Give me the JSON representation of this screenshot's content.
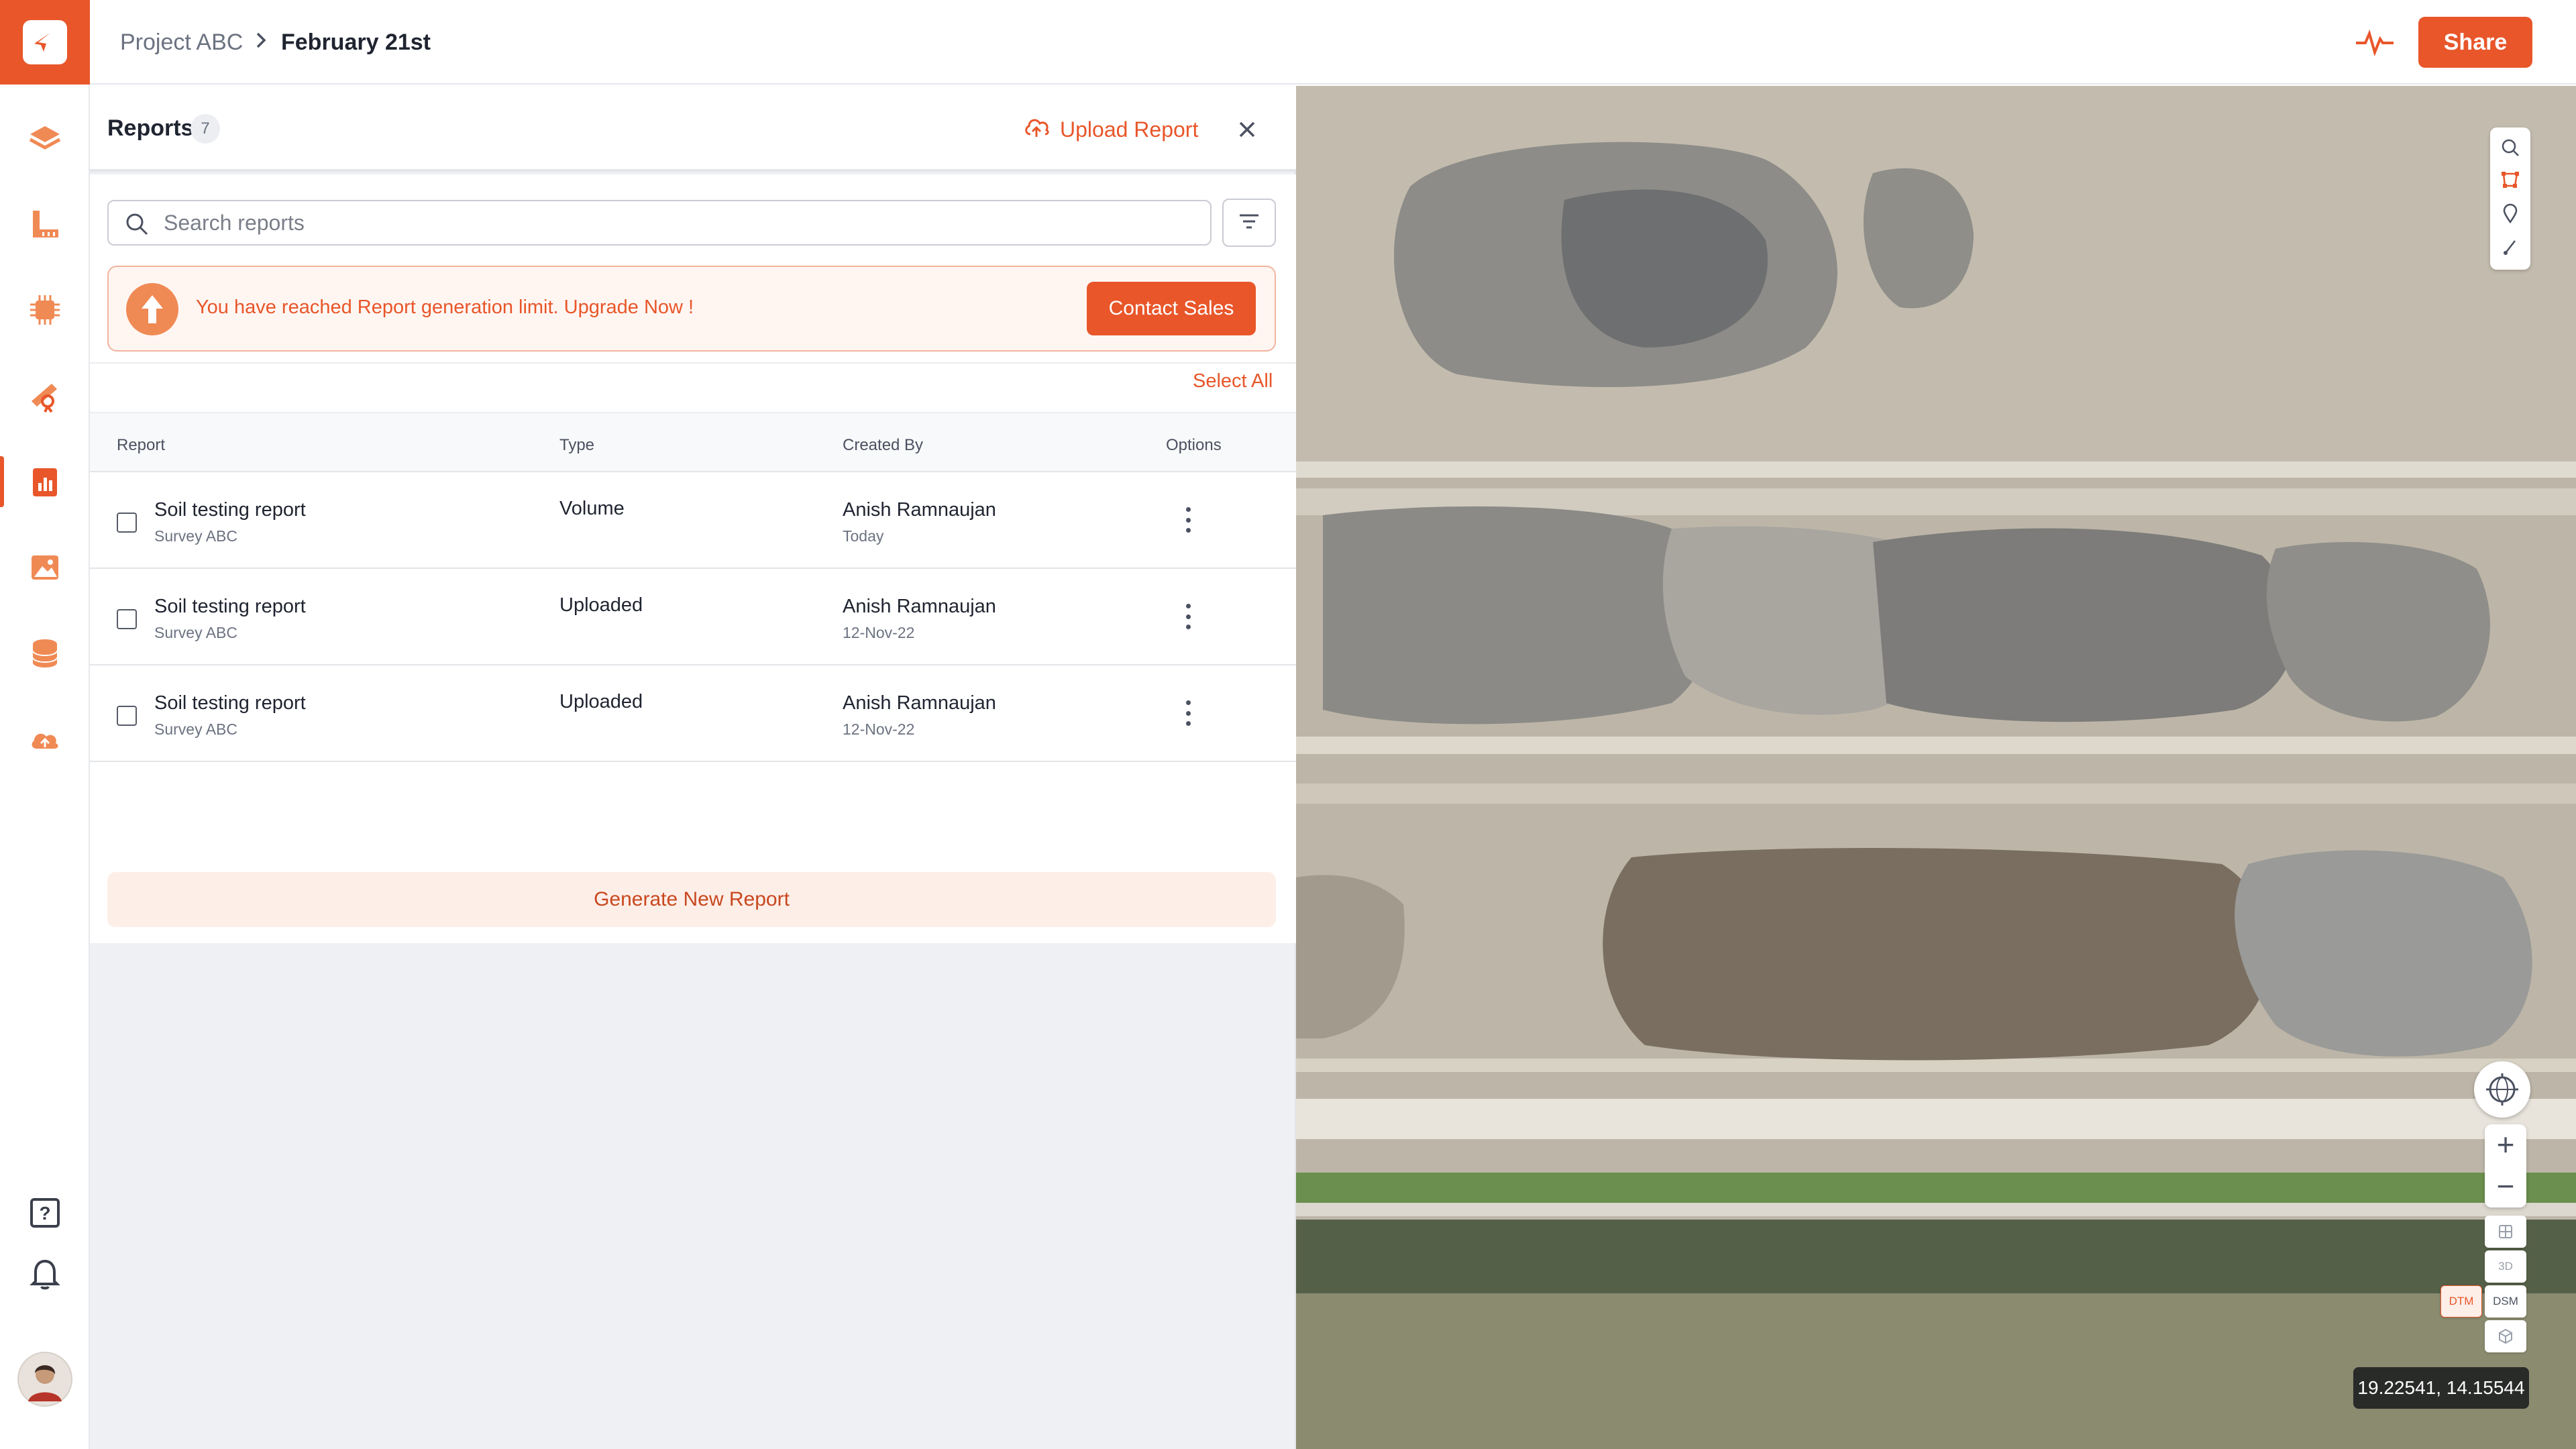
{
  "breadcrumb": {
    "project": "Project ABC",
    "date": "February 21st"
  },
  "header": {
    "share_label": "Share"
  },
  "panel": {
    "title": "Reports",
    "count": "7",
    "upload_label": "Upload Report",
    "search_placeholder": "Search reports",
    "limit_message": "You have reached Report generation limit. Upgrade Now !",
    "contact_label": "Contact Sales",
    "select_all_label": "Select All",
    "columns": {
      "report": "Report",
      "type": "Type",
      "created_by": "Created By",
      "options": "Options"
    },
    "rows": [
      {
        "title": "Soil testing report",
        "survey": "Survey ABC",
        "type": "Volume",
        "author": "Anish Ramnaujan",
        "date": "Today"
      },
      {
        "title": "Soil testing report",
        "survey": "Survey ABC",
        "type": "Uploaded",
        "author": "Anish Ramnaujan",
        "date": "12-Nov-22"
      },
      {
        "title": "Soil testing report",
        "survey": "Survey ABC",
        "type": "Uploaded",
        "author": "Anish Ramnaujan",
        "date": "12-Nov-22"
      }
    ],
    "generate_label": "Generate New Report"
  },
  "map": {
    "coordinates": "19.22541, 14.15544",
    "zoom_in": "+",
    "zoom_out": "−",
    "view_3d": "3D",
    "view_dtm": "DTM",
    "view_dsm": "DSM"
  },
  "theme": {
    "accent": "#e8562a",
    "accent_light": "#fdeee8"
  }
}
